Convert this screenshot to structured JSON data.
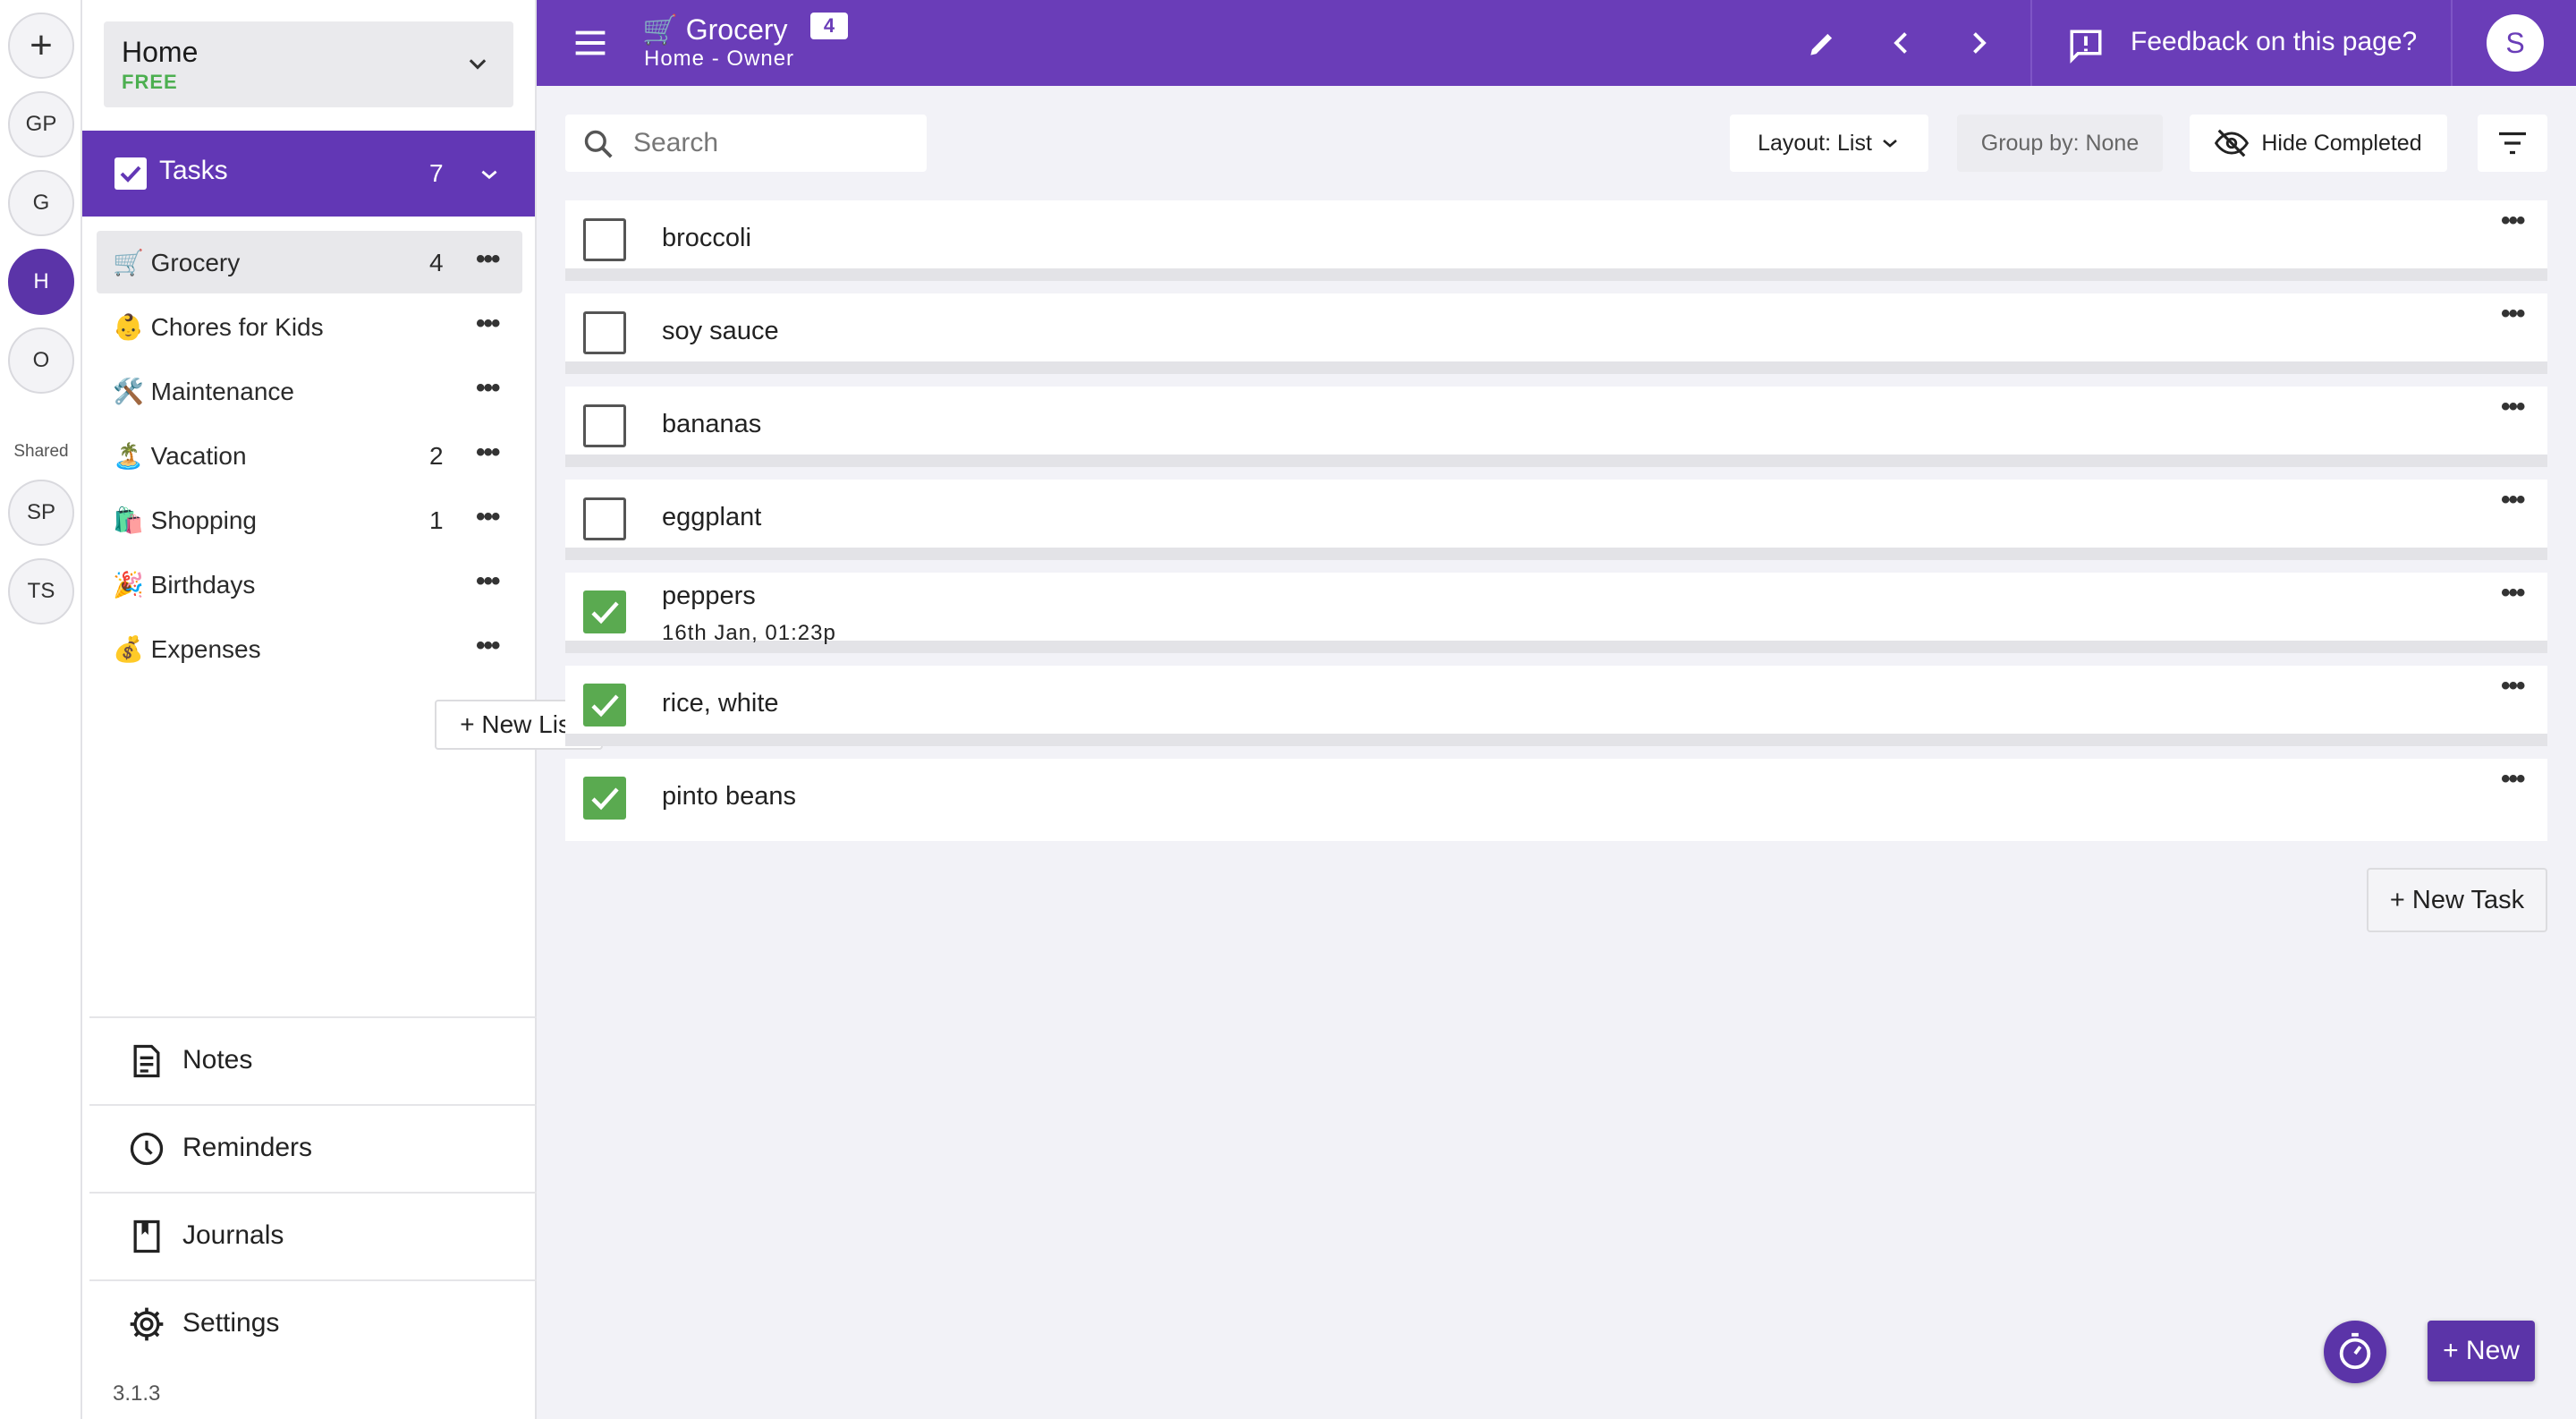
{
  "rail": {
    "add_label": "+",
    "workspaces": [
      "GP",
      "G",
      "H",
      "O"
    ],
    "shared_label": "Shared",
    "shared": [
      "SP",
      "TS"
    ]
  },
  "sidebar": {
    "workspace": {
      "name": "Home",
      "plan": "FREE"
    },
    "tasks": {
      "title": "Tasks",
      "count": "7"
    },
    "lists": [
      {
        "label": "🛒 Grocery",
        "count": "4"
      },
      {
        "label": "👶 Chores for Kids",
        "count": ""
      },
      {
        "label": "🛠️ Maintenance",
        "count": ""
      },
      {
        "label": "🏝️ Vacation",
        "count": "2"
      },
      {
        "label": "🛍️ Shopping",
        "count": "1"
      },
      {
        "label": "🎉 Birthdays",
        "count": ""
      },
      {
        "label": "💰 Expenses",
        "count": ""
      }
    ],
    "more_glyph": "•••",
    "new_list_label": "+ New List",
    "bottom_nav": [
      {
        "label": "Notes",
        "icon": "notes-icon"
      },
      {
        "label": "Reminders",
        "icon": "clock-icon"
      },
      {
        "label": "Journals",
        "icon": "journal-icon"
      },
      {
        "label": "Settings",
        "icon": "gear-icon"
      }
    ],
    "version": "3.1.3"
  },
  "topbar": {
    "title": "🛒 Grocery",
    "badge": "4",
    "subtitle": "Home - Owner",
    "feedback": "Feedback on this page?",
    "avatar": "S"
  },
  "toolbar": {
    "search_placeholder": "Search",
    "layout": "Layout: List",
    "group_by": "Group by: None",
    "hide_completed": "Hide Completed"
  },
  "tasks": [
    {
      "title": "broccoli",
      "done": false,
      "date": ""
    },
    {
      "title": "soy sauce",
      "done": false,
      "date": ""
    },
    {
      "title": "bananas",
      "done": false,
      "date": ""
    },
    {
      "title": "eggplant",
      "done": false,
      "date": ""
    },
    {
      "title": "peppers",
      "done": true,
      "date": "16th Jan, 01:23p"
    },
    {
      "title": "rice, white",
      "done": true,
      "date": ""
    },
    {
      "title": "pinto beans",
      "done": true,
      "date": ""
    }
  ],
  "new_task_label": "+ New Task",
  "fab_new_label": "+ New",
  "colors": {
    "primary": "#6a3db8",
    "done": "#5aaa50",
    "plan": "#4caf50"
  }
}
